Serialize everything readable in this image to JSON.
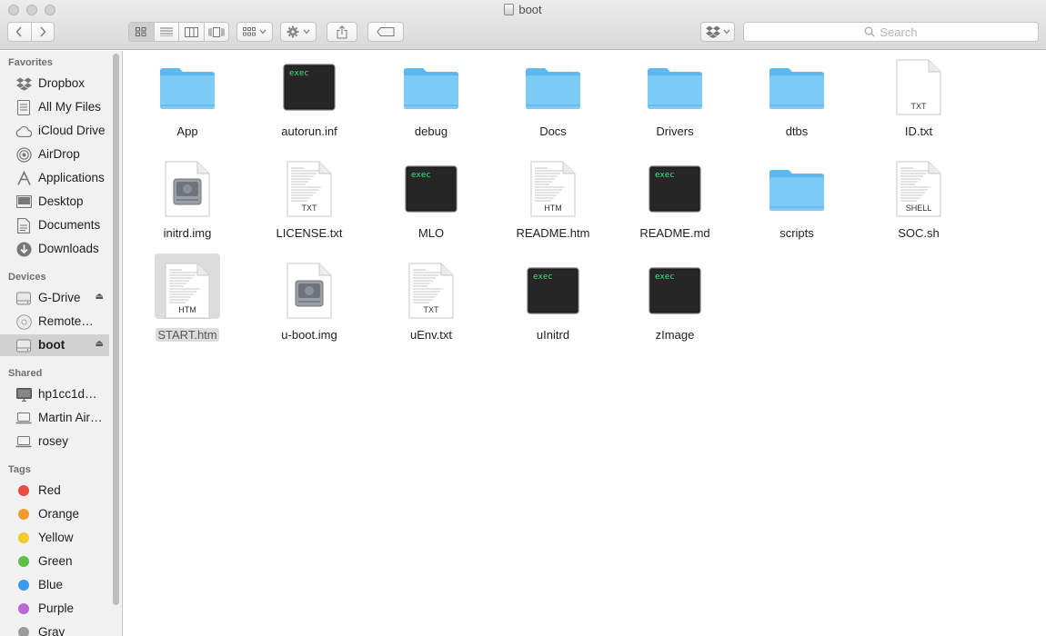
{
  "window": {
    "title": "boot"
  },
  "toolbar": {
    "search_placeholder": "Search"
  },
  "sidebar": {
    "favorites_heading": "Favorites",
    "favorites": [
      {
        "label": "Dropbox",
        "icon": "dropbox-icon"
      },
      {
        "label": "All My Files",
        "icon": "all-files-icon"
      },
      {
        "label": "iCloud Drive",
        "icon": "cloud-icon"
      },
      {
        "label": "AirDrop",
        "icon": "airdrop-icon"
      },
      {
        "label": "Applications",
        "icon": "applications-icon"
      },
      {
        "label": "Desktop",
        "icon": "desktop-icon"
      },
      {
        "label": "Documents",
        "icon": "documents-icon"
      },
      {
        "label": "Downloads",
        "icon": "downloads-icon"
      }
    ],
    "devices_heading": "Devices",
    "devices": [
      {
        "label": "G-Drive",
        "icon": "drive-icon",
        "eject": "⏏"
      },
      {
        "label": "Remote…",
        "icon": "disc-icon"
      },
      {
        "label": "boot",
        "icon": "drive-icon",
        "eject": "⏏",
        "selected": true
      }
    ],
    "shared_heading": "Shared",
    "shared": [
      {
        "label": "hp1cc1d…",
        "icon": "monitor-icon"
      },
      {
        "label": "Martin Air…",
        "icon": "laptop-icon"
      },
      {
        "label": "rosey",
        "icon": "laptop-icon"
      }
    ],
    "tags_heading": "Tags",
    "tags": [
      {
        "label": "Red",
        "color": "#ec4b45"
      },
      {
        "label": "Orange",
        "color": "#f39a2d"
      },
      {
        "label": "Yellow",
        "color": "#f2cb2e"
      },
      {
        "label": "Green",
        "color": "#5ac04a"
      },
      {
        "label": "Blue",
        "color": "#3b99f2"
      },
      {
        "label": "Purple",
        "color": "#b96ad1"
      },
      {
        "label": "Gray",
        "color": "#9b9b9b"
      }
    ]
  },
  "files": [
    {
      "name": "App",
      "kind": "folder"
    },
    {
      "name": "autorun.inf",
      "kind": "exec",
      "badge": "exec"
    },
    {
      "name": "debug",
      "kind": "folder"
    },
    {
      "name": "Docs",
      "kind": "folder"
    },
    {
      "name": "Drivers",
      "kind": "folder"
    },
    {
      "name": "dtbs",
      "kind": "folder"
    },
    {
      "name": "ID.txt",
      "kind": "doc",
      "badge": "TXT"
    },
    {
      "name": "initrd.img",
      "kind": "disk"
    },
    {
      "name": "LICENSE.txt",
      "kind": "doc-lines",
      "badge": "TXT"
    },
    {
      "name": "MLO",
      "kind": "exec",
      "badge": "exec"
    },
    {
      "name": "README.htm",
      "kind": "doc-lines",
      "badge": "HTM"
    },
    {
      "name": "README.md",
      "kind": "exec",
      "badge": "exec"
    },
    {
      "name": "scripts",
      "kind": "folder"
    },
    {
      "name": "SOC.sh",
      "kind": "doc-lines",
      "badge": "SHELL"
    },
    {
      "name": "START.htm",
      "kind": "doc-lines",
      "badge": "HTM",
      "selected": true
    },
    {
      "name": "u-boot.img",
      "kind": "disk"
    },
    {
      "name": "uEnv.txt",
      "kind": "doc-lines",
      "badge": "TXT"
    },
    {
      "name": "uInitrd",
      "kind": "exec",
      "badge": "exec"
    },
    {
      "name": "zImage",
      "kind": "exec",
      "badge": "exec"
    }
  ]
}
